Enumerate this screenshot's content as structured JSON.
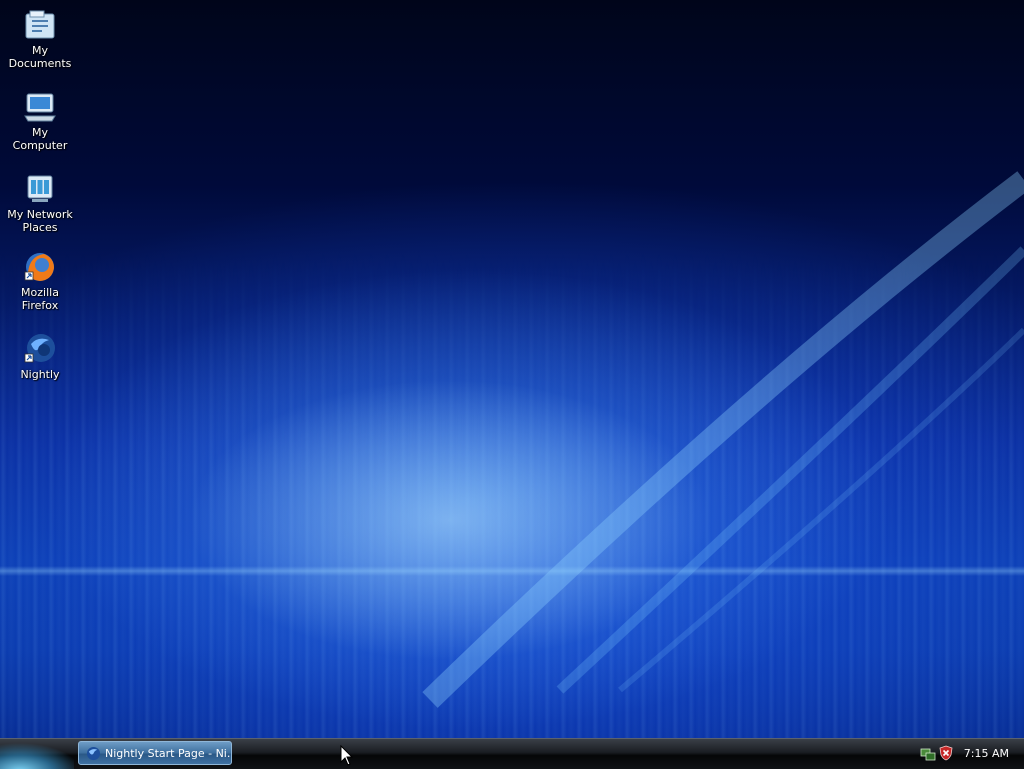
{
  "desktop": {
    "icons": [
      {
        "label": "My\nDocuments",
        "icon": "folder-documents-icon"
      },
      {
        "label": "My\nComputer",
        "icon": "computer-icon"
      },
      {
        "label": "My Network\nPlaces",
        "icon": "network-places-icon"
      },
      {
        "label": "Mozilla\nFirefox",
        "icon": "firefox-icon",
        "shortcut": true
      },
      {
        "label": "Nightly",
        "icon": "nightly-icon",
        "shortcut": true
      }
    ]
  },
  "taskbar": {
    "tasks": [
      {
        "label": "Nightly Start Page - Ni...",
        "icon": "nightly-icon"
      }
    ],
    "tray": {
      "icons": [
        "network-icon",
        "security-shield-icon"
      ],
      "clock": "7:15 AM"
    }
  },
  "colors": {
    "taskbar_dark": "#0a0c10",
    "task_button": "#3e6f9e",
    "wallpaper_blue": "#0c3fb0"
  }
}
